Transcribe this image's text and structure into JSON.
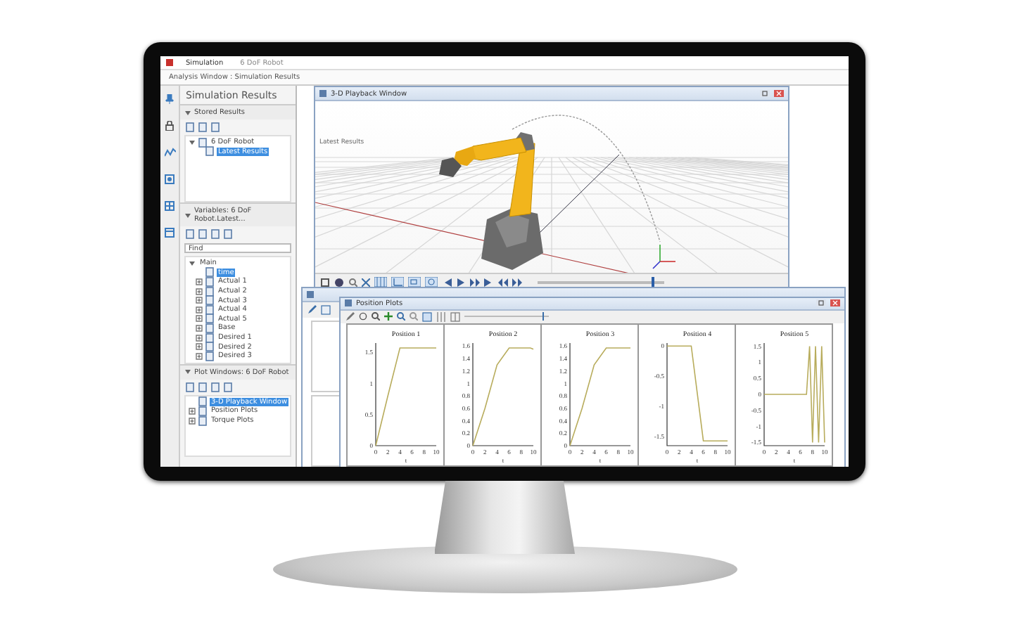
{
  "app": {
    "title_tabs": [
      {
        "label": "Simulation",
        "selected": true
      },
      {
        "label": "6 DoF Robot",
        "selected": false
      }
    ],
    "document_tab": "Analysis Window : Simulation Results"
  },
  "sidebar": {
    "title": "Simulation Results",
    "stored_results": {
      "heading": "Stored Results",
      "expanded": true,
      "tree": [
        {
          "label": "6 DoF Robot",
          "expanded": true,
          "children": [
            {
              "label": "Latest Results",
              "selected": true
            }
          ]
        }
      ]
    },
    "variables": {
      "heading": "Variables: 6 DoF Robot.Latest...",
      "expanded": true,
      "search": {
        "value": "Find"
      },
      "tree": [
        {
          "label": "Main",
          "expanded": true,
          "children": [
            {
              "label": "time",
              "selected": true
            },
            {
              "label": "Actual 1",
              "expanded": false,
              "selected": false
            },
            {
              "label": "Actual 2",
              "expanded": false,
              "selected": false
            },
            {
              "label": "Actual 3",
              "expanded": false,
              "selected": false
            },
            {
              "label": "Actual 4",
              "expanded": false,
              "selected": false
            },
            {
              "label": "Actual 5",
              "expanded": false,
              "selected": false
            },
            {
              "label": "Base",
              "expanded": false,
              "selected": false
            },
            {
              "label": "Desired 1",
              "expanded": false,
              "selected": false
            },
            {
              "label": "Desired 2",
              "expanded": false,
              "selected": false
            },
            {
              "label": "Desired 3",
              "expanded": false,
              "selected": false
            }
          ]
        }
      ]
    },
    "plot_windows": {
      "heading": "Plot Windows: 6 DoF Robot",
      "expanded": true,
      "tree": [
        {
          "label": "3-D Playback Window",
          "selected": true
        },
        {
          "label": "Position Plots",
          "expanded": false,
          "selected": false
        },
        {
          "label": "Torque Plots",
          "expanded": false,
          "selected": false
        }
      ]
    }
  },
  "playback_window": {
    "title": "3-D Playback Window",
    "view_label": "Latest Results",
    "timeline": {
      "level": 0.9
    }
  },
  "plot_window": {
    "title": "Position Plots",
    "charts": [
      {
        "chart_data": {
          "type": "line",
          "title": "Position 1",
          "xlabel": "t",
          "x": [
            0,
            2,
            4,
            6,
            7,
            7.5,
            8,
            8.5,
            9,
            9.5,
            10
          ],
          "series": [
            {
              "color": "#b8ac5c",
              "values": [
                0,
                0.8,
                1.57,
                1.57,
                1.57,
                1.57,
                1.57,
                1.57,
                1.57,
                1.57,
                1.57
              ]
            }
          ],
          "xlim": [
            0,
            10
          ],
          "ylim": [
            0,
            1.65
          ],
          "xticks": [
            0,
            2,
            4,
            6,
            8,
            10
          ],
          "yticks": [
            0,
            0.5,
            1,
            1.5
          ]
        }
      },
      {
        "chart_data": {
          "type": "line",
          "title": "Position 2",
          "xlabel": "t",
          "x": [
            0,
            2,
            4,
            6,
            7,
            7.5,
            8,
            8.5,
            9,
            9.5,
            10
          ],
          "series": [
            {
              "color": "#b8ac5c",
              "values": [
                0,
                0.6,
                1.3,
                1.57,
                1.57,
                1.57,
                1.57,
                1.57,
                1.57,
                1.57,
                1.55
              ]
            }
          ],
          "xlim": [
            0,
            10
          ],
          "ylim": [
            0,
            1.65
          ],
          "xticks": [
            0,
            2,
            4,
            6,
            8,
            10
          ],
          "yticks": [
            0,
            0.2,
            0.4,
            0.6,
            0.8,
            1,
            1.2,
            1.4,
            1.6
          ]
        }
      },
      {
        "chart_data": {
          "type": "line",
          "title": "Position 3",
          "xlabel": "t",
          "x": [
            0,
            2,
            4,
            6,
            7,
            7.5,
            8,
            8.5,
            9,
            9.5,
            10
          ],
          "series": [
            {
              "color": "#b8ac5c",
              "values": [
                0,
                0.6,
                1.3,
                1.57,
                1.57,
                1.57,
                1.57,
                1.57,
                1.57,
                1.57,
                1.57
              ]
            }
          ],
          "xlim": [
            0,
            10
          ],
          "ylim": [
            0,
            1.65
          ],
          "xticks": [
            0,
            2,
            4,
            6,
            8,
            10
          ],
          "yticks": [
            0,
            0.2,
            0.4,
            0.6,
            0.8,
            1,
            1.2,
            1.4,
            1.6
          ]
        }
      },
      {
        "chart_data": {
          "type": "line",
          "title": "Position 4",
          "xlabel": "t",
          "x": [
            0,
            2,
            4,
            6,
            7,
            7.5,
            8,
            8.5,
            9,
            9.5,
            10
          ],
          "series": [
            {
              "color": "#b8ac5c",
              "values": [
                0,
                0,
                0,
                -1.57,
                -1.57,
                -1.57,
                -1.57,
                -1.57,
                -1.57,
                -1.57,
                -1.57
              ]
            }
          ],
          "xlim": [
            0,
            10
          ],
          "ylim": [
            -1.65,
            0.05
          ],
          "xticks": [
            0,
            2,
            4,
            6,
            8,
            10
          ],
          "yticks": [
            -1.5,
            -1,
            -0.5,
            0
          ]
        }
      },
      {
        "chart_data": {
          "type": "line",
          "title": "Position 5",
          "xlabel": "t",
          "x": [
            0,
            2,
            4,
            6,
            7,
            7.5,
            8,
            8.5,
            9,
            9.5,
            10
          ],
          "series": [
            {
              "color": "#b8ac5c",
              "values": [
                0,
                0,
                0,
                0,
                0,
                1.5,
                -1.5,
                1.5,
                -1.5,
                1.5,
                -1.5
              ]
            }
          ],
          "xlim": [
            0,
            10
          ],
          "ylim": [
            -1.6,
            1.6
          ],
          "xticks": [
            0,
            2,
            4,
            6,
            8,
            10
          ],
          "yticks": [
            -1.5,
            -1,
            -0.5,
            0,
            0.5,
            1,
            1.5
          ]
        }
      }
    ]
  }
}
